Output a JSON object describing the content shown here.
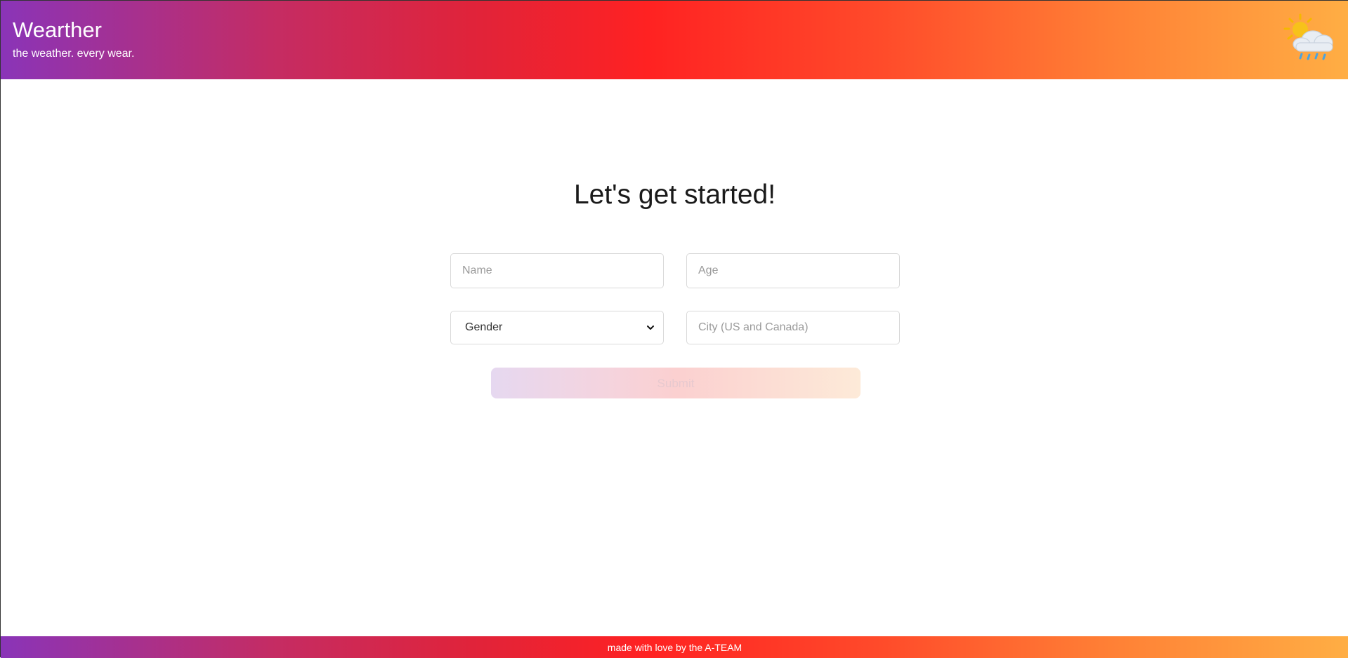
{
  "header": {
    "title": "Wearther",
    "tagline": "the weather. every wear.",
    "logo_icon": "sun-behind-rain-cloud-icon",
    "gradient_colors": [
      "#8a34b8",
      "#c42c64",
      "#ff2222",
      "#ff7f35",
      "#ffae44"
    ]
  },
  "form": {
    "heading": "Let's get started!",
    "name_placeholder": "Name",
    "age_placeholder": "Age",
    "gender_selected": "Gender",
    "city_placeholder": "City (US and Canada)",
    "submit_label": "Submit",
    "submit_state": "disabled"
  },
  "footer": {
    "text": "made with love by the A-TEAM"
  }
}
